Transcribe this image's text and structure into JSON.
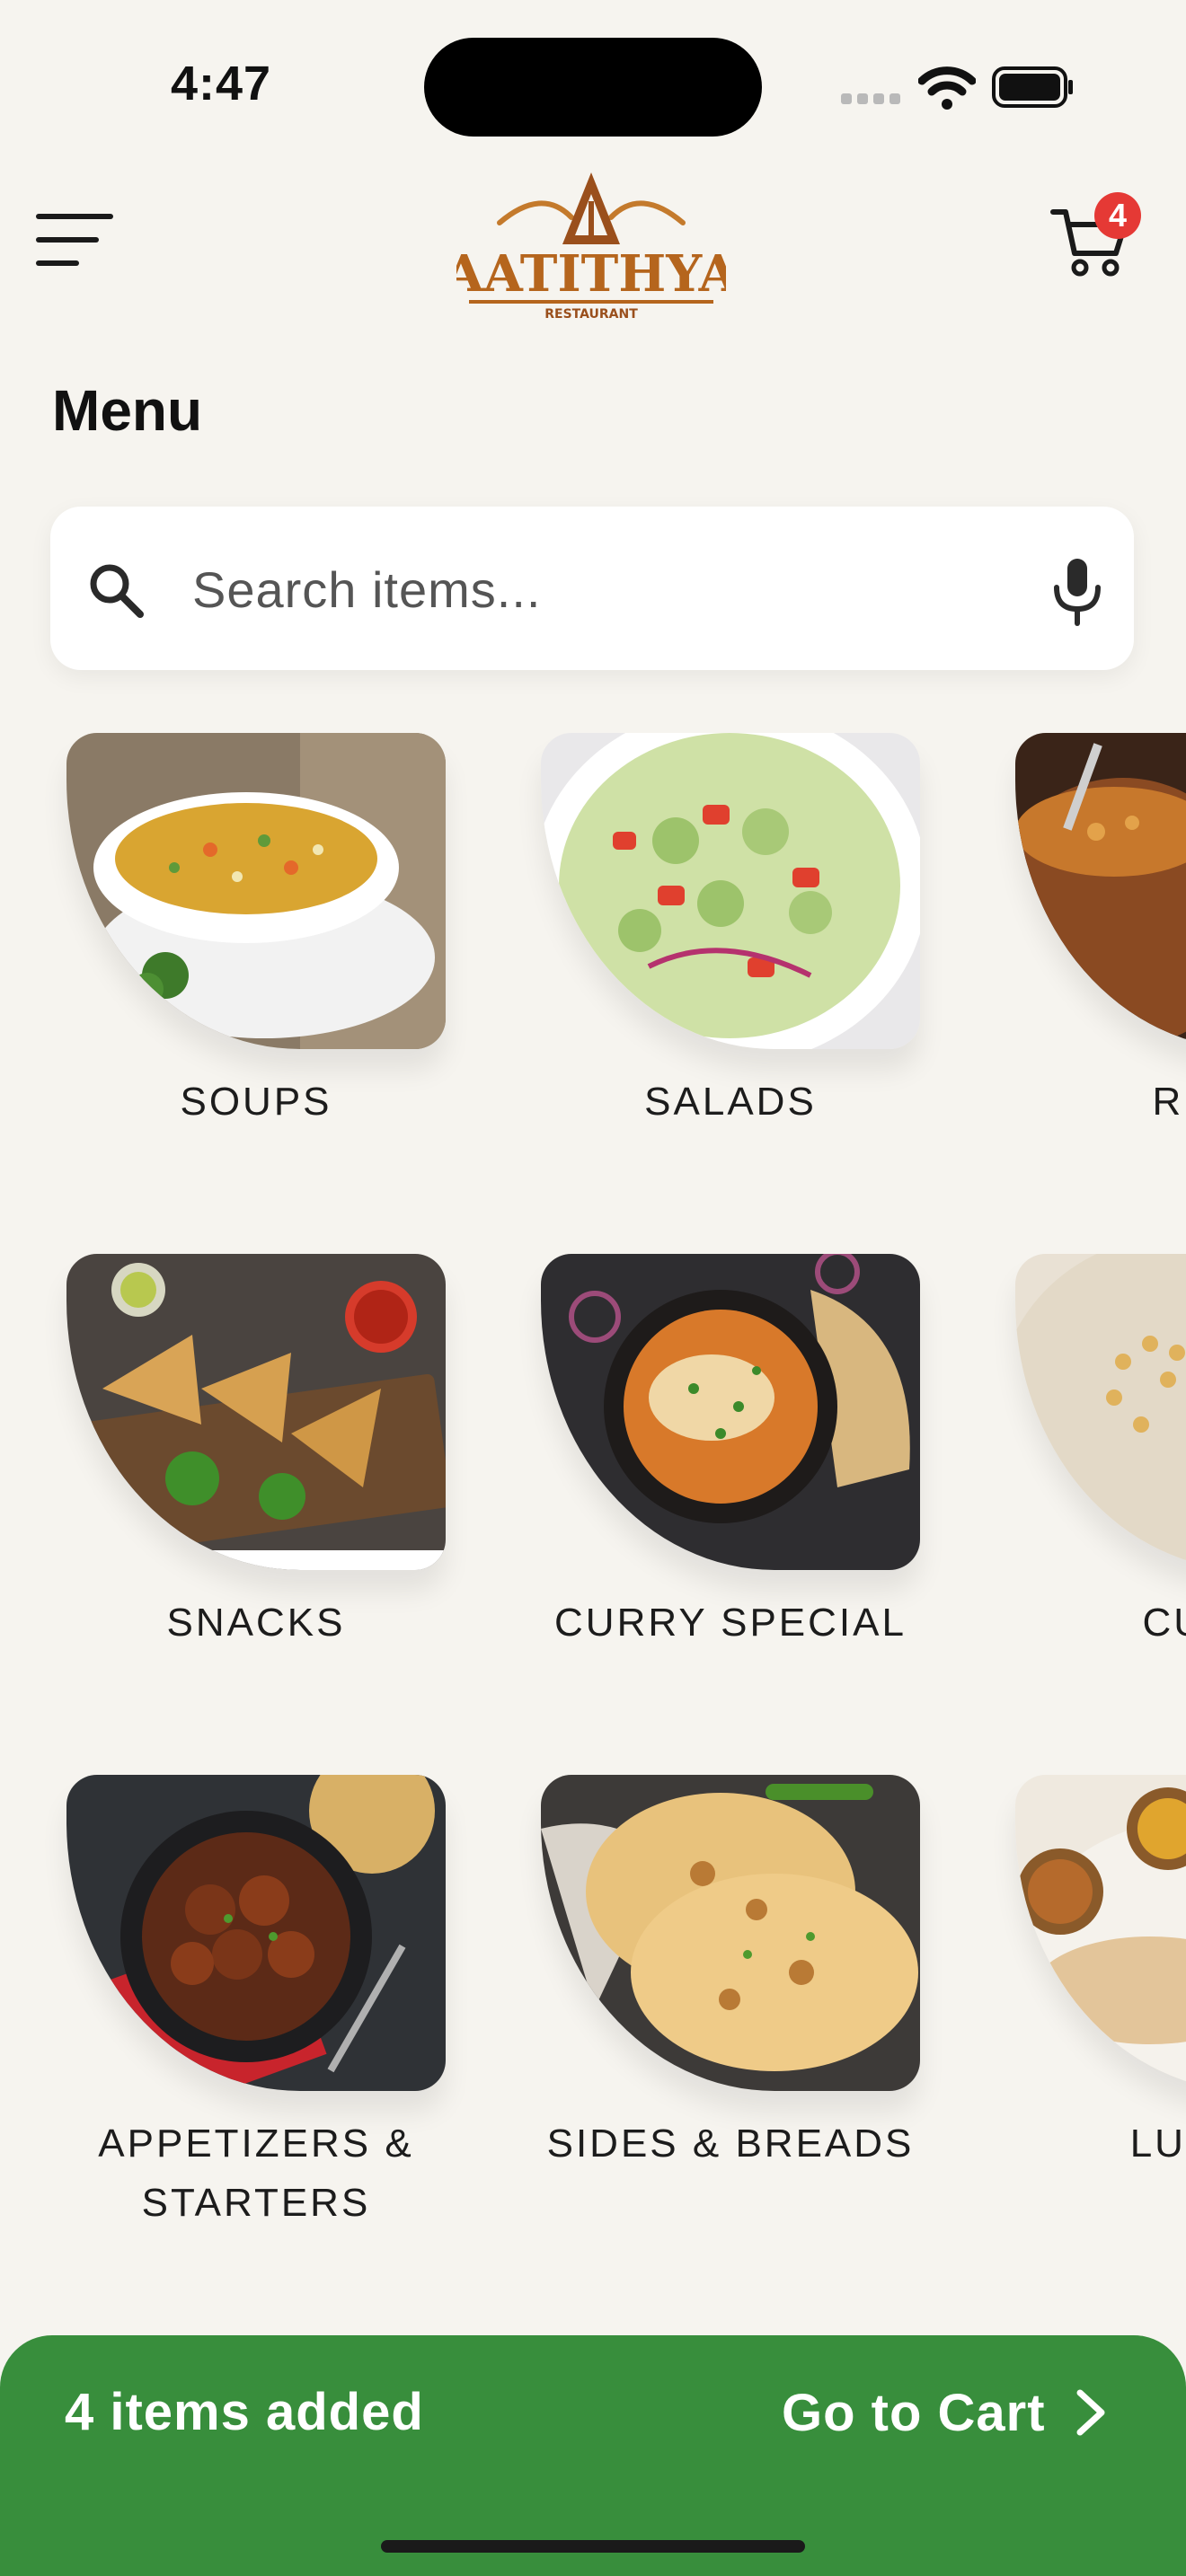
{
  "status": {
    "time": "4:47"
  },
  "header": {
    "logo_text": "AATITHYA",
    "logo_subtext": "RESTAURANT",
    "cart_count": "4"
  },
  "page": {
    "title": "Menu"
  },
  "search": {
    "placeholder": "Search items...",
    "value": ""
  },
  "categories": [
    {
      "label": "SOUPS",
      "image": "soup"
    },
    {
      "label": "SALADS",
      "image": "salad"
    },
    {
      "label": "RICE",
      "image": "rice"
    },
    {
      "label": "SNACKS",
      "image": "snacks"
    },
    {
      "label": "CURRY SPECIAL",
      "image": "curry"
    },
    {
      "label": "CURD",
      "image": "curd"
    },
    {
      "label": "APPETIZERS & STARTERS",
      "image": "appetizers"
    },
    {
      "label": "SIDES & BREADS",
      "image": "breads"
    },
    {
      "label": "LUNCH",
      "image": "lunch"
    }
  ],
  "cart_bar": {
    "summary": "4 items added",
    "action": "Go to Cart"
  },
  "colors": {
    "background": "#f6f4ef",
    "accent_green": "#388e3c",
    "badge_red": "#e53935",
    "logo_brown": "#b5651d"
  }
}
